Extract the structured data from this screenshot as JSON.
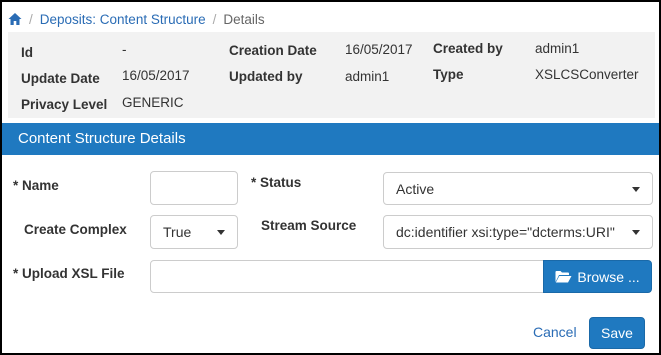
{
  "breadcrumb": {
    "items": [
      "Deposits: Content Structure",
      "Details"
    ],
    "separator": "/"
  },
  "info": {
    "id_label": "Id",
    "id_value": "-",
    "creation_date_label": "Creation Date",
    "creation_date_value": "16/05/2017",
    "created_by_label": "Created by",
    "created_by_value": "admin1",
    "update_date_label": "Update Date",
    "update_date_value": "16/05/2017",
    "updated_by_label": "Updated by",
    "updated_by_value": "admin1",
    "type_label": "Type",
    "type_value": "XSLCSConverter",
    "privacy_level_label": "Privacy Level",
    "privacy_level_value": "GENERIC"
  },
  "section": {
    "title": "Content Structure Details"
  },
  "form": {
    "name_label": "* Name",
    "name_value": "",
    "status_label": "* Status",
    "status_value": "Active",
    "create_complex_label": "Create Complex",
    "create_complex_value": "True",
    "stream_source_label": "Stream Source",
    "stream_source_value": "dc:identifier xsi:type=\"dcterms:URI\"",
    "upload_xsl_label": "* Upload XSL File",
    "upload_value": "",
    "browse_label": "Browse ..."
  },
  "actions": {
    "cancel_label": "Cancel",
    "save_label": "Save"
  },
  "colors": {
    "accent": "#1f79c0",
    "link": "#2a6cb5",
    "info_bg": "#f2f2f2"
  }
}
